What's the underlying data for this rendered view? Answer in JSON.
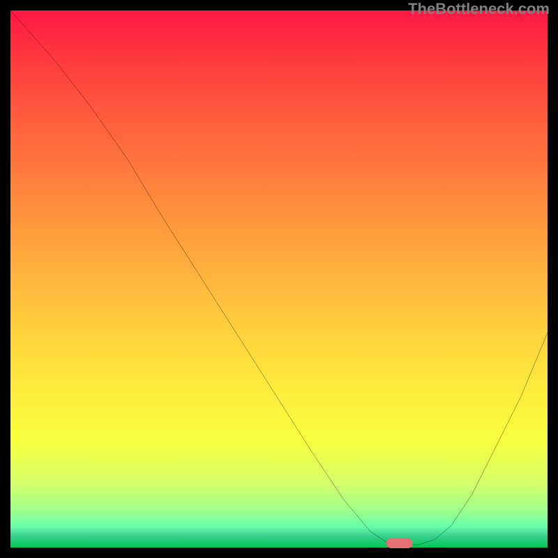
{
  "watermark": "TheBottleneck.com",
  "chart_data": {
    "type": "line",
    "title": "",
    "xlabel": "",
    "ylabel": "",
    "xlim": [
      0,
      100
    ],
    "ylim": [
      0,
      100
    ],
    "curve": [
      {
        "x": 0,
        "y": 100
      },
      {
        "x": 8,
        "y": 91
      },
      {
        "x": 15,
        "y": 82
      },
      {
        "x": 22,
        "y": 72
      },
      {
        "x": 28,
        "y": 62
      },
      {
        "x": 35,
        "y": 51
      },
      {
        "x": 42,
        "y": 40
      },
      {
        "x": 49,
        "y": 29
      },
      {
        "x": 56,
        "y": 18
      },
      {
        "x": 62,
        "y": 9
      },
      {
        "x": 67,
        "y": 3
      },
      {
        "x": 70,
        "y": 1
      },
      {
        "x": 73,
        "y": 0.5
      },
      {
        "x": 76,
        "y": 0.5
      },
      {
        "x": 79,
        "y": 1.5
      },
      {
        "x": 82,
        "y": 4
      },
      {
        "x": 86,
        "y": 10
      },
      {
        "x": 90,
        "y": 18
      },
      {
        "x": 95,
        "y": 28
      },
      {
        "x": 100,
        "y": 40
      }
    ],
    "marker": {
      "x": 72.5,
      "y": 0.8
    },
    "background": "rainbow-gradient-red-to-green"
  }
}
